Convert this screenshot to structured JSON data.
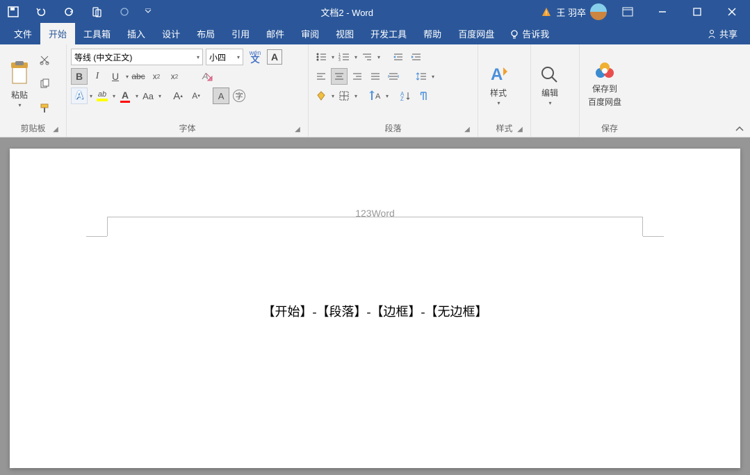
{
  "titlebar": {
    "doc_title": "文档2 - Word",
    "user_name": "王 羽卒"
  },
  "tabs": {
    "file": "文件",
    "home": "开始",
    "toolbox": "工具箱",
    "insert": "插入",
    "design": "设计",
    "layout": "布局",
    "references": "引用",
    "mailings": "邮件",
    "review": "审阅",
    "view": "视图",
    "developer": "开发工具",
    "help": "帮助",
    "baidu": "百度网盘",
    "tell_me": "告诉我",
    "share": "共享"
  },
  "ribbon": {
    "clipboard": {
      "paste": "粘贴",
      "label": "剪贴板"
    },
    "font": {
      "name": "等线 (中文正文)",
      "size": "小四",
      "label": "字体"
    },
    "paragraph": {
      "label": "段落"
    },
    "styles": {
      "btn": "样式",
      "label": "样式"
    },
    "editing": {
      "btn": "编辑"
    },
    "save": {
      "btn_l1": "保存到",
      "btn_l2": "百度网盘",
      "label": "保存"
    }
  },
  "document": {
    "header_text": "123Word",
    "body_text": "【开始】-【段落】-【边框】-【无边框】"
  }
}
